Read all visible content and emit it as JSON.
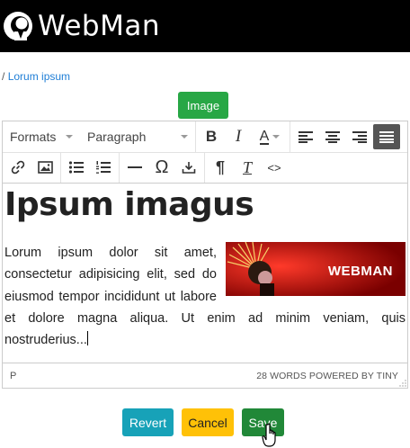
{
  "header": {
    "logo_text": "WebMan"
  },
  "breadcrumb": {
    "separator": "/",
    "link": "Lorum ipsum"
  },
  "image_button": {
    "label": "Image"
  },
  "toolbar": {
    "formats_label": "Formats",
    "block_label": "Paragraph",
    "row1_icons": [
      "bold-icon",
      "italic-icon",
      "text-color-icon",
      "align-left-icon",
      "align-center-icon",
      "align-right-icon",
      "align-justify-icon"
    ],
    "row2_icons": [
      "link-icon",
      "image-icon",
      "bullet-list-icon",
      "numbered-list-icon",
      "horizontal-rule-icon",
      "special-char-icon",
      "insert-icon",
      "paragraph-mark-icon",
      "clear-format-icon",
      "source-code-icon"
    ],
    "bold_glyph": "B",
    "italic_glyph": "I",
    "color_glyph": "A",
    "omega_glyph": "Ω",
    "pilcrow_glyph": "¶",
    "clear_glyph": "T",
    "code_glyph": "<>"
  },
  "content": {
    "heading": "Ipsum imagus",
    "paragraph": "Lorum ipsum dolor sit amet, consectetur adipisicing elit, sed do eiusmod tempor incididunt ut labore et dolore magna aliqua. Ut enim ad minim veniam, quis nostruderius...",
    "image_text": "WEBMAN"
  },
  "statusbar": {
    "path": "P",
    "info": "28 WORDS POWERED BY TINY"
  },
  "actions": {
    "revert": "Revert",
    "cancel": "Cancel",
    "save": "Save"
  },
  "colors": {
    "header_bg": "#000000",
    "link": "#1f7ed6",
    "image_btn": "#28a745",
    "revert": "#17a2b8",
    "cancel": "#ffc107",
    "save": "#218838",
    "image_bg": "#b30a0a"
  }
}
